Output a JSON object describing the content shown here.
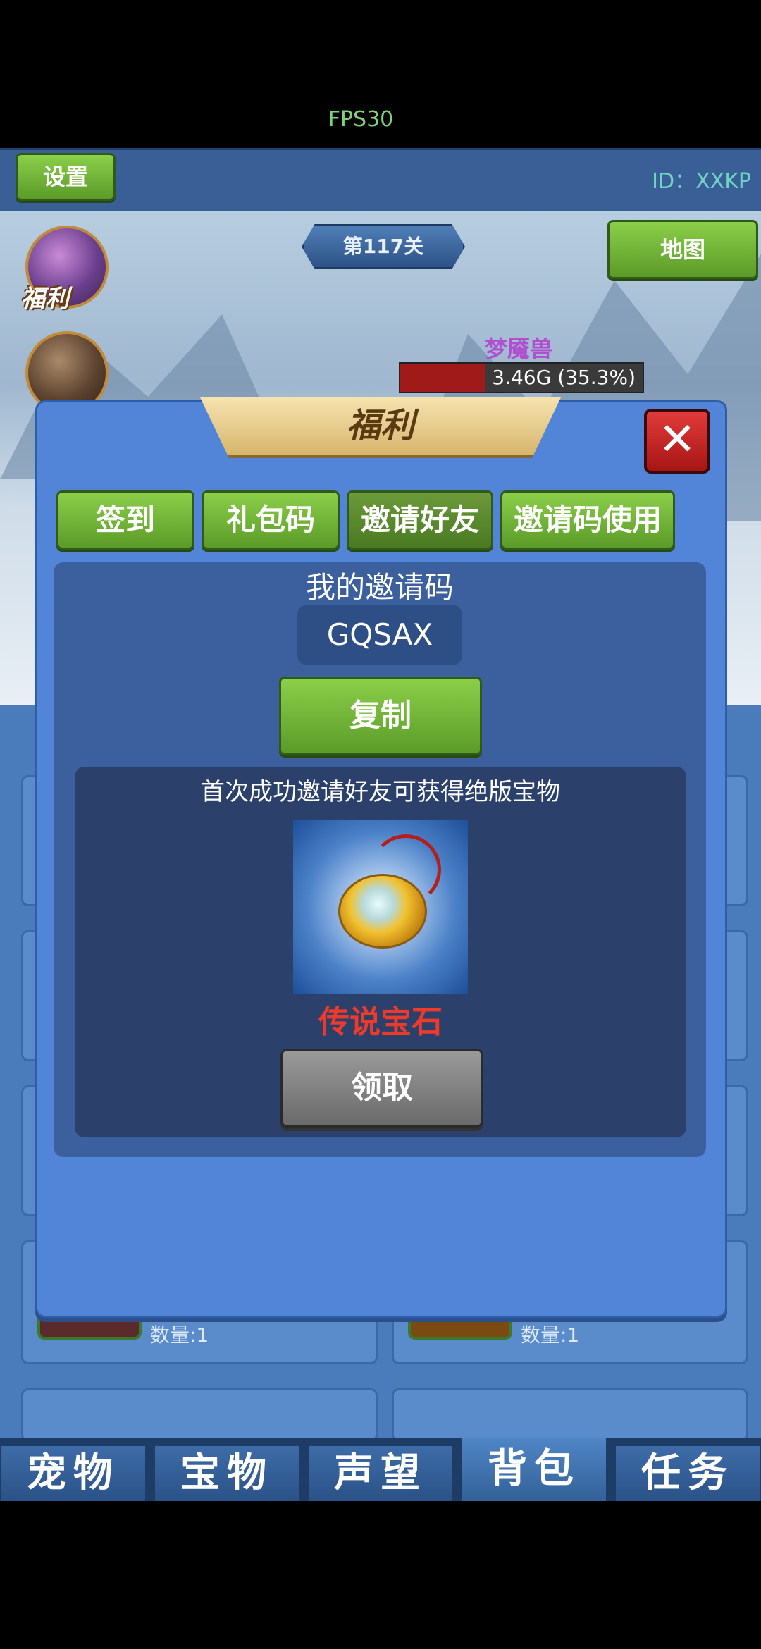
{
  "status": {
    "fps": "FPS30"
  },
  "topbar": {
    "settings_label": "设置",
    "id_text": "ID：XXKP"
  },
  "scene": {
    "stage_label": "第117关",
    "map_label": "地图",
    "welfare_label": "福利",
    "monster_name": "梦魇兽",
    "hp_text": "3.46G (35.3%)",
    "hp_fraction": 0.353
  },
  "background_items": [
    {
      "qty": "数量:1"
    },
    {
      "qty": "数量:1"
    }
  ],
  "dialog": {
    "title": "福利",
    "close_symbol": "✕",
    "tabs": [
      {
        "label": "签到",
        "active": false
      },
      {
        "label": "礼包码",
        "active": false
      },
      {
        "label": "邀请好友",
        "active": true
      },
      {
        "label": "邀请码使用",
        "active": false
      }
    ],
    "my_code_label": "我的邀请码",
    "invite_code": "GQSAX",
    "copy_label": "复制",
    "reward_text": "首次成功邀请好友可获得绝版宝物",
    "reward_item_name": "传说宝石",
    "claim_label": "领取"
  },
  "bottom_nav": [
    {
      "label": "宠物",
      "active": false
    },
    {
      "label": "宝物",
      "active": false
    },
    {
      "label": "声望",
      "active": false
    },
    {
      "label": "背包",
      "active": true
    },
    {
      "label": "任务",
      "active": false
    }
  ],
  "colors": {
    "accent_green": "#7cc43a",
    "panel_blue": "#5285d8",
    "legend_red": "#ee3a2a"
  }
}
